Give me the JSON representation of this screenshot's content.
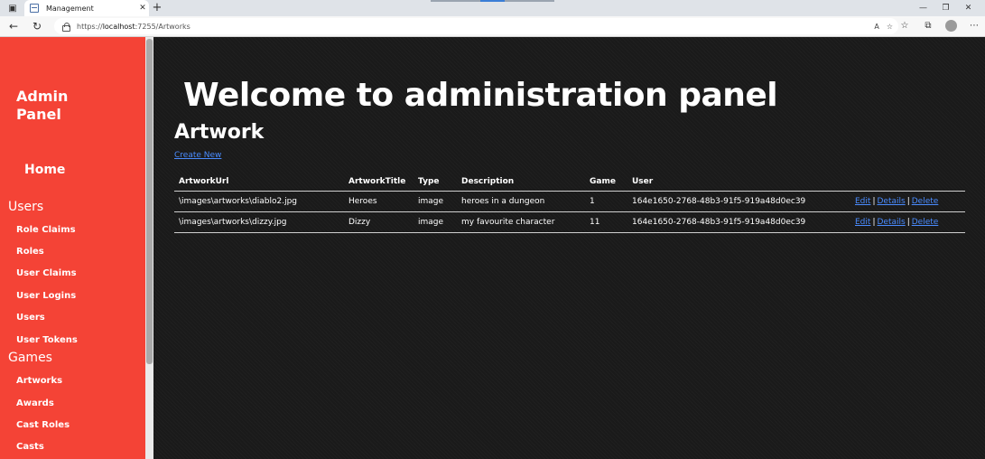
{
  "browser": {
    "tab_title": "Management",
    "tab_close": "✕",
    "new_tab": "+",
    "url_prefix": "https://",
    "url_host": "localhost",
    "url_rest": ":7255/Artworks",
    "read_aloud": "A",
    "window_controls": [
      "—",
      "❐",
      "✕"
    ]
  },
  "sidebar": {
    "brand": "Admin Panel",
    "home": "Home",
    "sections": [
      {
        "title": "Users",
        "items": [
          "Role Claims",
          "Roles",
          "User Claims",
          "User Logins",
          "Users",
          "User Tokens"
        ]
      },
      {
        "title": "Games",
        "items": [
          "Artworks",
          "Awards",
          "Cast Roles",
          "Casts"
        ]
      }
    ],
    "color": "#f44336"
  },
  "main": {
    "welcome": "Welcome to administration panel",
    "heading": "Artwork",
    "create_link": "Create New",
    "table": {
      "columns": [
        "ArtworkUrl",
        "ArtworkTitle",
        "Type",
        "Description",
        "Game",
        "User"
      ],
      "rows": [
        [
          "\\images\\artworks\\diablo2.jpg",
          "Heroes",
          "image",
          "heroes in a dungeon",
          "1",
          "164e1650-2768-48b3-91f5-919a48d0ec39"
        ],
        [
          "\\images\\artworks\\dizzy.jpg",
          "Dizzy",
          "image",
          "my favourite character",
          "11",
          "164e1650-2768-48b3-91f5-919a48d0ec39"
        ]
      ],
      "actions": [
        "Edit",
        "Details",
        "Delete"
      ],
      "action_separator": "|"
    },
    "link_color": "#4a8cff"
  }
}
